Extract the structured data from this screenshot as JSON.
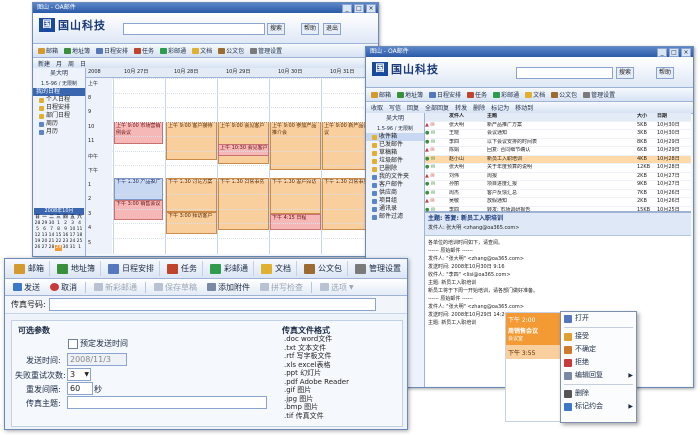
{
  "app": {
    "brand": "国山科技",
    "logo_mark": "国",
    "window_title": "图山 - OA邮件",
    "user_name": "吴大明",
    "user_role": "1.5-96 / 无限制"
  },
  "header": {
    "search_btn": "搜索",
    "nav": [
      "帮助",
      "退出"
    ],
    "help": "帮助"
  },
  "calendar_window": {
    "toolbar": [
      "邮箱",
      "地址簿",
      "日程安排",
      "任务",
      "彩邮通",
      "文档",
      "公文包",
      "管理设置"
    ],
    "subtoolbar": [
      "新建",
      "月",
      "周",
      "日"
    ],
    "year": "2008",
    "days": [
      "10月 27日",
      "10月 28日",
      "10月 29日",
      "10月 30日",
      "10月 31日"
    ],
    "hours": [
      "上午",
      "8",
      "9",
      "10",
      "11",
      "中午",
      "下午",
      "1",
      "2",
      "3",
      "4",
      "5"
    ],
    "sidebar_head": "我的日程",
    "sidebar_items": [
      "个人日程",
      "日程安排",
      "部门日程",
      "周历",
      "月历"
    ],
    "mini_cal_title": "2008年10月",
    "mini_cal_rows": [
      [
        "日",
        "一",
        "二",
        "三",
        "四",
        "五",
        "六"
      ],
      [
        "28",
        "29",
        "30",
        "1",
        "2",
        "3",
        "4"
      ],
      [
        "5",
        "6",
        "7",
        "8",
        "9",
        "10",
        "11"
      ],
      [
        "12",
        "13",
        "14",
        "15",
        "16",
        "17",
        "18"
      ],
      [
        "19",
        "20",
        "21",
        "22",
        "23",
        "24",
        "25"
      ],
      [
        "26",
        "27",
        "28",
        "29",
        "30",
        "31",
        "1"
      ]
    ],
    "events": [
      {
        "col": 0,
        "text": "上午 9:00 市场营销例会议"
      },
      {
        "col": 1,
        "text": "上午 9:00 客户接待"
      },
      {
        "col": 2,
        "text": "上午 9:00 会见客户"
      },
      {
        "col": 2,
        "text": "上午 10:30 会见客户"
      },
      {
        "col": 3,
        "text": "上午 9:00 参加产品推介会"
      },
      {
        "col": 4,
        "text": "上午 9:00 新产品会议"
      },
      {
        "col": 0,
        "text": "下午 1:30 产品推广"
      },
      {
        "col": 0,
        "text": "下午 3:00 销售会议"
      },
      {
        "col": 1,
        "text": "下午 1:30 讨论方案"
      },
      {
        "col": 1,
        "text": "下午 3:00 拜访客户"
      },
      {
        "col": 2,
        "text": "下午 1:30 日常事务"
      },
      {
        "col": 3,
        "text": "下午 1:30 客户拜访"
      },
      {
        "col": 3,
        "text": "下午 4:15 日程"
      },
      {
        "col": 4,
        "text": "下午 1:30 日常事务"
      }
    ]
  },
  "mail_window": {
    "toolbar": [
      "邮箱",
      "地址簿",
      "日程安排",
      "任务",
      "彩邮通",
      "文档",
      "公文包",
      "管理设置"
    ],
    "subtoolbar": [
      "收取",
      "写信",
      "回复",
      "全部回复",
      "转发",
      "删除",
      "标记为",
      "移动到"
    ],
    "folders": [
      "收件箱",
      "已发邮件",
      "草稿箱",
      "垃圾邮件",
      "已删除",
      "我的文件夹",
      "客户邮件",
      "供应商",
      "项目组",
      "通讯录",
      "邮件过滤"
    ],
    "list_header": [
      "",
      "发件人",
      "主题",
      "大小",
      "日期"
    ],
    "messages": [
      {
        "from": "张大明",
        "subject": "新产品推广方案",
        "size": "5KB",
        "date": "10月30日"
      },
      {
        "from": "王晓",
        "subject": "会议通知",
        "size": "3KB",
        "date": "10月30日"
      },
      {
        "from": "李四",
        "subject": "以下会议安排的时间表",
        "size": "8KB",
        "date": "10月29日"
      },
      {
        "from": "陈娟",
        "subject": "回复: 合同细节确认",
        "size": "6KB",
        "date": "10月29日"
      },
      {
        "from": "赵小山",
        "subject": "新员工入职培训",
        "size": "4KB",
        "date": "10月28日"
      },
      {
        "from": "张大明",
        "subject": "关于年度预算的说明",
        "size": "12KB",
        "date": "10月28日"
      },
      {
        "from": "刘伟",
        "subject": "周报",
        "size": "2KB",
        "date": "10月27日"
      },
      {
        "from": "孙丽",
        "subject": "项目进度汇报",
        "size": "9KB",
        "date": "10月27日"
      },
      {
        "from": "周杰",
        "subject": "客户反馈汇总",
        "size": "7KB",
        "date": "10月26日"
      },
      {
        "from": "吴敏",
        "subject": "放假通知",
        "size": "2KB",
        "date": "10月26日"
      },
      {
        "from": "李四",
        "subject": "转发: 市场调研报告",
        "size": "15KB",
        "date": "10月25日"
      }
    ],
    "preview_subject": "主题: 答复: 新员工入职培训",
    "preview_from": "发件人: 张大明 <zhang@oa365.com>",
    "preview_body": [
      "各单位的培训时间如下，请查阅。",
      "------ 原始邮件 ------",
      "发件人: \"张大明\" <zhang@oa365.com>",
      "发送时间: 2008年10月30日 9:16",
      "收件人: \"李四\" <lisi@oa365.com>",
      "主题: 新员工入职培训",
      "新员工将于下周一开始培训，请各部门做好准备。",
      "------ 原始邮件 ------",
      "发件人: \"张大明\" <zhang@oa365.com>",
      "发送时间: 2008年10月29日 14:20",
      "主题: 新员工入职培训"
    ]
  },
  "fax_window": {
    "tabs": [
      "邮箱",
      "地址簿",
      "日程安排",
      "任务",
      "彩邮通",
      "文档",
      "公文包",
      "管理设置"
    ],
    "actions": [
      "发送",
      "取消",
      "新彩邮通",
      "保存草稿",
      "添加附件",
      "拼写检查",
      "选项"
    ],
    "fax_number_label": "传真号码:",
    "fax_number_value": "",
    "params_title": "可选参数",
    "scheduled_checkbox_label": "预定发送时间",
    "send_time_label": "发送时间:",
    "send_time_value": "2008/11/3",
    "retry_label": "失败重试次数:",
    "retry_value": "3",
    "interval_label": "重发间隔:",
    "interval_value": "60",
    "interval_unit": "秒",
    "subject_label": "传真主题:",
    "subject_value": "",
    "formats_title": "传真文件格式",
    "formats": [
      ".doc  word文件",
      ".txt  文本文件",
      ".rtf  写字板文件",
      ".xls  excel表格",
      ".ppt  幻灯片",
      ".pdf  Adobe Reader",
      ".gif  图片",
      ".jpg  图片",
      ".bmp  图片",
      ".tif  传真文件"
    ]
  },
  "event_snippet": {
    "time1": "下午 2:00",
    "title": "周销售会议",
    "sub": "会议室",
    "time2": "下午 3:55"
  },
  "context_menu": {
    "items": [
      "打开",
      "接受",
      "不确定",
      "拒绝",
      "编辑回复",
      "删除",
      "标记约会"
    ]
  },
  "colors": {
    "accent": "#3a66b0",
    "event_red": "#f6b7b7",
    "event_orange": "#f9cf9e",
    "event_blue": "#c9d8f2"
  }
}
